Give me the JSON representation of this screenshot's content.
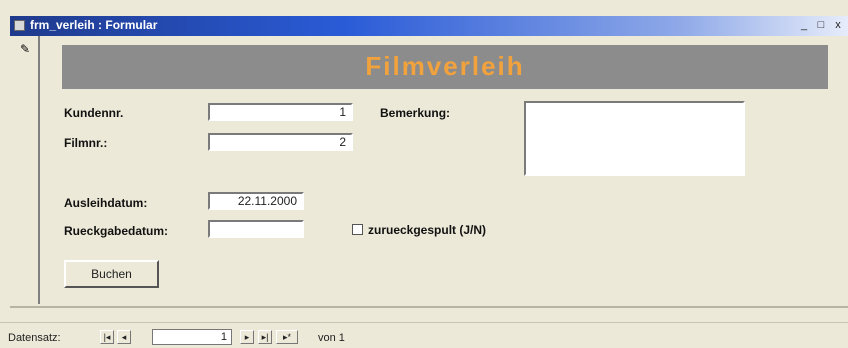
{
  "window": {
    "title": "frm_verleih : Formular",
    "controls": {
      "minimize": "_",
      "maximize": "□",
      "close": "x"
    }
  },
  "record_selector": {
    "icon": "pencil-icon"
  },
  "header": {
    "title": "Filmverleih"
  },
  "form": {
    "kundennr": {
      "label": "Kundennr.",
      "value": "1"
    },
    "filmnr": {
      "label": "Filmnr.:",
      "value": "2"
    },
    "bemerkung": {
      "label": "Bemerkung:",
      "value": ""
    },
    "ausleihdatum": {
      "label": "Ausleihdatum:",
      "value": "22.11.2000"
    },
    "rueckgabedatum": {
      "label": "Rueckgabedatum:",
      "value": ""
    },
    "zurueckgespult": {
      "label": "zurueckgespult (J/N)",
      "checked": false
    },
    "buchen_button": "Buchen"
  },
  "navigation": {
    "label": "Datensatz:",
    "first": "|◂",
    "prev": "◂",
    "current": "1",
    "next": "▸",
    "last": "▸|",
    "new": "▸*",
    "of_text": "von 1"
  }
}
